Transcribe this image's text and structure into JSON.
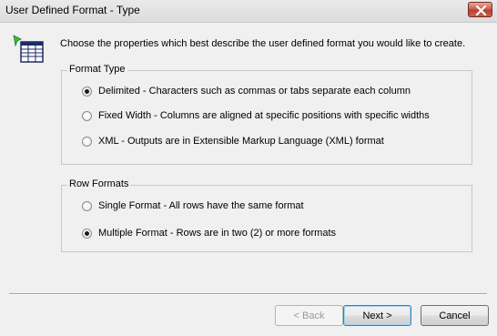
{
  "window": {
    "title": "User Defined Format - Type"
  },
  "intro_text": "Choose the properties which best describe the user defined format you would like to create.",
  "format_type": {
    "legend": "Format Type",
    "options": [
      {
        "label": "Delimited - Characters such as commas or tabs separate each column",
        "selected": true
      },
      {
        "label": "Fixed Width - Columns are aligned at specific positions with specific widths",
        "selected": false
      },
      {
        "label": "XML - Outputs are in Extensible Markup Language (XML) format",
        "selected": false
      }
    ]
  },
  "row_formats": {
    "legend": "Row Formats",
    "options": [
      {
        "label": "Single Format - All rows have the same format",
        "selected": false
      },
      {
        "label": "Multiple Format - Rows are in two (2) or more formats",
        "selected": true
      }
    ]
  },
  "buttons": {
    "back": "< Back",
    "next": "Next >",
    "cancel": "Cancel"
  },
  "colors": {
    "close_button": "#c75a48",
    "default_button_border": "#3c7fb1"
  }
}
